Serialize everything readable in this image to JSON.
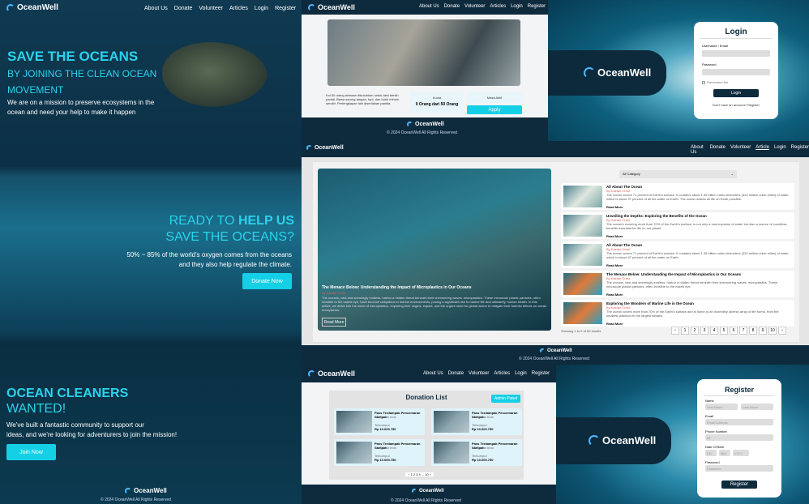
{
  "brand": {
    "name": "OceanWell"
  },
  "nav": [
    "About Us",
    "Donate",
    "Volunteer",
    "Articles",
    "Login",
    "Register"
  ],
  "home": {
    "hero_title": "SAVE THE OCEANS",
    "hero_sub1": "BY JOINING THE CLEAN OCEAN",
    "hero_sub2": "MOVEMENT",
    "hero_text1": "We are on a mission to preserve ecosystems in the",
    "hero_text2": "ocean and need your help to make it happen",
    "ready_line1_a": "READY TO ",
    "ready_line1_b": "HELP US",
    "ready_line2": "SAVE THE OCEANS?",
    "oxygen_text1": "50% ~ 85% of the world's oxygen comes from the oceans",
    "oxygen_text2": "and they also help regulate the climate.",
    "donate_btn": "Donate Now",
    "cleaners_title": "OCEAN CLEANERS",
    "cleaners_sub": "WANTED!",
    "cleaners_text1": "We've built a fantastic community to support our",
    "cleaners_text2": "ideas, and we're looking for adventurers to join the mission!",
    "join_btn": "Join Now",
    "footer": "© 2024 OceanWell All Rights Reserved"
  },
  "volunteer": {
    "desc": "Kol 50 orang relawan dibutuhkan untuk aksi bersih pantai. Bawa sarung tangan, topi, dan botol minum sendiri. Perlengkapan lain disediakan panitia.",
    "quota_label": "Kuota",
    "quota_value": "0 Orang dari 50 Orang",
    "date_label": "Masa Aktif",
    "apply_btn": "Apply",
    "footer": "© 2024 OceanWell All Rights Reserved"
  },
  "login": {
    "title": "Login",
    "user_label": "Username / Email",
    "pass_label": "Password",
    "remember": "Remember Me",
    "btn": "Login",
    "footer_link": "Don't have an account? Register"
  },
  "articles": {
    "nav_active": "Article",
    "filter": "All Category",
    "featured_title": "The Menace Below: Understanding the Impact of Microplastics in Our Oceans",
    "featured_author": "By Kaelan Crest",
    "featured_text": "The oceans, vast and seemingly endless, harbor a hidden threat beneath their shimmering waves: microplastics. These minuscule plastic particles, often invisible to the naked eye, have become ubiquitous in marine environments, posing a significant risk to marine life and ultimately, human health. In this article, we delve into the world of microplastics, exploring their origins, impact, and the urgent need for global action to mitigate their harmful effects on ocean ecosystems.",
    "read_more": "Read More",
    "list": [
      {
        "title": "All About The Ocean",
        "author": "By Kaelan Crest",
        "text": "The ocean covers 71 percent of Earth's surface. It contains about 1.35 billion cubic kilometers (324 million cubic miles) of water, which is about 97 percent of all the water on Earth. The ocean makes all life on Earth possible.",
        "more": "Read More"
      },
      {
        "title": "Unveiling the Depths: Exploring the Benefits of the Ocean",
        "author": "By Kaelan Crest",
        "text": "The ocean's covering more than 70% of the Earth's surface, is not only a vast expanse of water but also a source of countless benefits essential for life on our planet.",
        "more": "Read More"
      },
      {
        "title": "All About The Ocean",
        "author": "By Kaelan Crest",
        "text": "The ocean covers 71 percent of Earth's surface. It contains about 1.35 billion cubic kilometers (324 million cubic miles) of water, which is about 97 percent of all the water on Earth.",
        "more": "Read More"
      },
      {
        "title": "The Menace Below: Understanding the Impact of Microplastics in Our Oceans",
        "author": "By Kaelan Crest",
        "text": "The oceans, vast and seemingly endless, harbor a hidden threat beneath their shimmering waves: microplastics. These minuscule plastic particles, often invisible to the naked eye.",
        "more": "Read More"
      },
      {
        "title": "Exploring the Wonders of Marine Life in the Ocean",
        "author": "By Kaelan Crest",
        "text": "The ocean covers more than 70% of the Earth's surface and is home to an incredibly diverse array of life forms, from the smallest plankton to the largest whales.",
        "more": "Read More"
      }
    ],
    "showing": "Showing 1 to 5 of 50 results",
    "pages": [
      "‹",
      "1",
      "2",
      "3",
      "4",
      "5",
      "6",
      "7",
      "8",
      "9",
      "10",
      "›"
    ],
    "footer": "© 2024 OceanWell All Rights Reserved"
  },
  "donations": {
    "title": "Donation List",
    "admin_btn": "Admin Panel",
    "cards": [
      {
        "title": "Pass Terdampak Pencemaran Sampah",
        "org": "PT Ocean Indo",
        "target_label": "Terkumpul",
        "amount": "Rp 10.000.750"
      },
      {
        "title": "Pass Terdampak Pencemaran Sampah",
        "org": "PT Ocean Indo",
        "target_label": "Terkumpul",
        "amount": "Rp 10.000.750"
      },
      {
        "title": "Pass Terdampak Pencemaran Sampah",
        "org": "PT Ocean Indo",
        "target_label": "Terkumpul",
        "amount": "Rp 10.000.750"
      },
      {
        "title": "Pass Terdampak Pencemaran Sampah",
        "org": "PT Ocean Indo",
        "target_label": "Terkumpul",
        "amount": "Rp 10.000.750"
      }
    ],
    "pager": "‹ 1 2 3 4 ... 10 ›",
    "footer": "© 2024 OceanWell All Rights Reserved"
  },
  "register": {
    "title": "Register",
    "name_label": "Name",
    "first_ph": "First Name",
    "last_ph": "Last Name",
    "email_label": "Email",
    "email_ph": "Email Address",
    "phone_label": "Phone Number",
    "phone_ph": "08",
    "dob_label": "Date Of Birth",
    "dob_d": "DD",
    "dob_m": "MM",
    "dob_y": "YYYY",
    "pass_label": "Password",
    "pass_ph": "Password",
    "btn": "Register"
  }
}
